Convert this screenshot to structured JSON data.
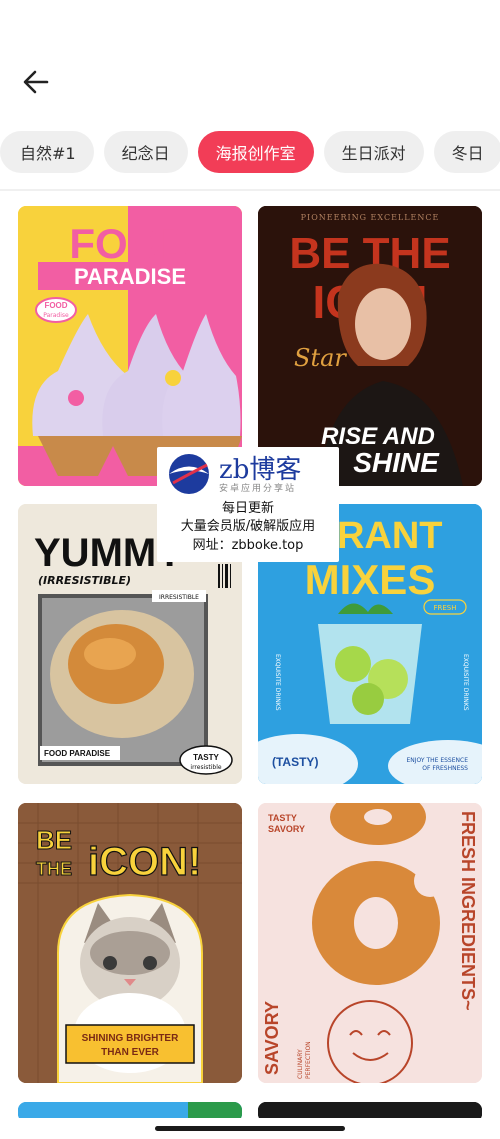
{
  "header": {
    "back_icon": "arrow-left-icon"
  },
  "chips": [
    {
      "label": "自然#1",
      "active": false
    },
    {
      "label": "纪念日",
      "active": false
    },
    {
      "label": "海报创作室",
      "active": true
    },
    {
      "label": "生日派对",
      "active": false
    },
    {
      "label": "冬日",
      "active": false
    }
  ],
  "colors": {
    "accent": "#f23d57",
    "chip_bg": "#efefef"
  },
  "posters": {
    "p1": {
      "line1": "FOOD",
      "line2": "PARADISE",
      "badge1": "FOOD",
      "badge2": "Paradise"
    },
    "p2": {
      "top": "PIONEERING EXCELLENCE",
      "line1": "BE THE",
      "line2": "ICON",
      "script": "Star",
      "line3": "RISE AND",
      "line4": "SHINE"
    },
    "p3": {
      "line1": "YUMMY",
      "line2": "(IRRESISTIBLE)",
      "tag": "IRRESISTIBLE",
      "footer": "FOOD PARADISE",
      "badge1": "TASTY",
      "badge2": "irresistible"
    },
    "p4": {
      "line1": "BRANT",
      "line2": "MIXES",
      "pill": "FRESH",
      "side_left": "EXQUISITE DRINKS",
      "side_right": "EXQUISITE DRINKS",
      "bottom_left": "(TASTY)",
      "bottom_right1": "ENJOY THE ESSENCE",
      "bottom_right2": "OF FRESHNESS"
    },
    "p5": {
      "line1": "BE",
      "line2": "THE",
      "line3": "iCON!",
      "banner1": "SHINING BRIGHTER",
      "banner2": "THAN EVER"
    },
    "p6": {
      "top1": "TASTY",
      "top2": "SAVORY",
      "vertical_right": "FRESH INGREDIENTS~",
      "vertical_left": "SAVORY",
      "small1": "CULINARY",
      "small2": "PERFECTION"
    }
  },
  "watermark": {
    "brand": "zb博客",
    "subtitle": "安卓应用分享站",
    "line1": "每日更新",
    "line2": "大量会员版/破解版应用",
    "line3": "网址：zbboke.top"
  }
}
